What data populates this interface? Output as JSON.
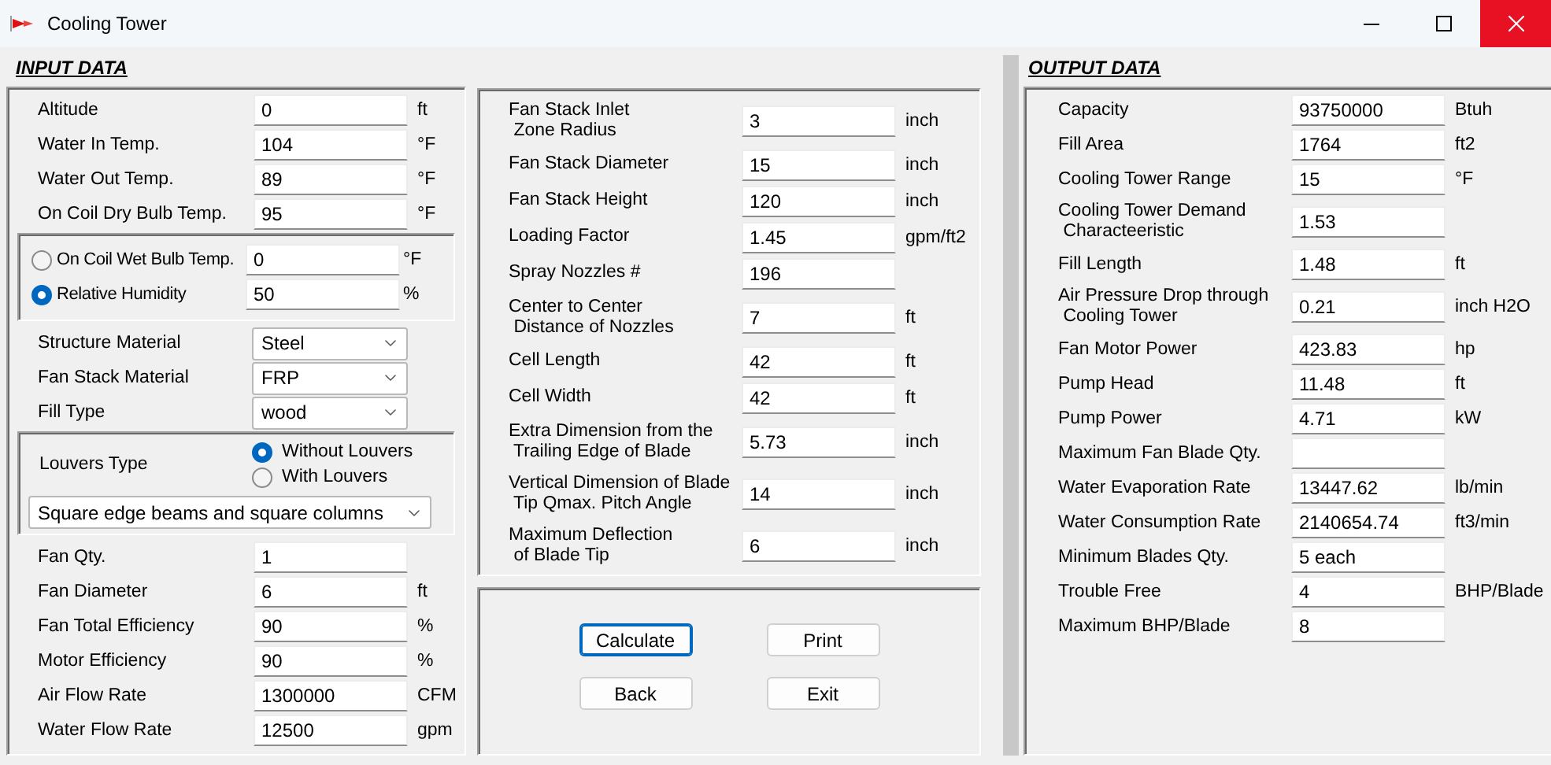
{
  "window": {
    "title": "Cooling Tower"
  },
  "input_data": {
    "title": "INPUT DATA",
    "basic_fields": [
      {
        "label": "Altitude",
        "value": "0",
        "unit": "ft"
      },
      {
        "label": "Water In Temp.",
        "value": "104",
        "unit": "°F"
      },
      {
        "label": "Water Out Temp.",
        "value": "89",
        "unit": "°F"
      },
      {
        "label": "On Coil Dry Bulb Temp.",
        "value": "95",
        "unit": "°F"
      }
    ],
    "humidity_options": [
      {
        "label": "On Coil Wet Bulb Temp.",
        "value": "0",
        "unit": "°F",
        "selected": false
      },
      {
        "label": "Relative Humidity",
        "value": "50",
        "unit": "%",
        "selected": true
      }
    ],
    "dropdowns": [
      {
        "label": "Structure Material",
        "value": "Steel"
      },
      {
        "label": "Fan Stack Material",
        "value": "FRP"
      },
      {
        "label": "Fill Type",
        "value": "wood"
      }
    ],
    "louvers": {
      "label": "Louvers Type",
      "options": [
        {
          "label": "Without Louvers",
          "selected": true
        },
        {
          "label": "With Louvers",
          "selected": false
        }
      ],
      "construction": "Square edge beams and square columns"
    },
    "fan_fields": [
      {
        "label": "Fan Qty.",
        "value": "1"
      },
      {
        "label": "Fan Diameter",
        "value": "6",
        "unit": "ft"
      },
      {
        "label": "Fan Total Efficiency",
        "value": "90",
        "unit": "%"
      },
      {
        "label": "Motor Efficiency",
        "value": "90",
        "unit": "%"
      },
      {
        "label": "Air Flow Rate",
        "value": "1300000",
        "unit": "CFM"
      },
      {
        "label": "Water Flow Rate",
        "value": "12500",
        "unit": "gpm"
      }
    ]
  },
  "fan_stack": {
    "fields": [
      {
        "label": "Fan Stack Inlet\n Zone Radius",
        "value": "3",
        "unit": "inch"
      },
      {
        "label": "Fan Stack Diameter",
        "value": "15",
        "unit": "inch"
      },
      {
        "label": "Fan Stack Height",
        "value": "120",
        "unit": "inch"
      },
      {
        "label": "Loading Factor",
        "value": "1.45",
        "unit": "gpm/ft2"
      },
      {
        "label": "Spray Nozzles #",
        "value": "196"
      },
      {
        "label": "Center to Center\n Distance of Nozzles",
        "value": "7",
        "unit": "ft"
      },
      {
        "label": "Cell Length",
        "value": "42",
        "unit": "ft"
      },
      {
        "label": "Cell Width",
        "value": "42",
        "unit": "ft"
      },
      {
        "label": "Extra Dimension from the\n Trailing Edge of Blade",
        "value": "5.73",
        "unit": "inch"
      },
      {
        "label": "Vertical Dimension of Blade\n Tip Qmax. Pitch Angle",
        "value": "14",
        "unit": "inch"
      },
      {
        "label": "Maximum Deflection\n of Blade Tip",
        "value": "6",
        "unit": "inch"
      }
    ]
  },
  "buttons": [
    {
      "label": "Calculate",
      "focused": true
    },
    {
      "label": "Print",
      "focused": false
    },
    {
      "label": "Back",
      "focused": false
    },
    {
      "label": "Exit",
      "focused": false
    }
  ],
  "output_data": {
    "title": "OUTPUT DATA",
    "fields": [
      {
        "label": "Capacity",
        "value": "93750000",
        "unit": "Btuh"
      },
      {
        "label": "Fill Area",
        "value": "1764",
        "unit": "ft2"
      },
      {
        "label": "Cooling Tower Range",
        "value": "15",
        "unit": "°F"
      },
      {
        "label": "Cooling Tower Demand\n Characteeristic",
        "value": "1.53"
      },
      {
        "label": "Fill Length",
        "value": "1.48",
        "unit": "ft"
      },
      {
        "label": "Air Pressure Drop through\n Cooling Tower",
        "value": "0.21",
        "unit": "inch H2O"
      },
      {
        "label": "Fan Motor Power",
        "value": "423.83",
        "unit": "hp"
      },
      {
        "label": "Pump Head",
        "value": "11.48",
        "unit": "ft"
      },
      {
        "label": "Pump Power",
        "value": "4.71",
        "unit": "kW"
      },
      {
        "label": "Maximum Fan Blade Qty."
      },
      {
        "label": "Water Evaporation Rate",
        "value": "13447.62",
        "unit": "lb/min"
      },
      {
        "label": "Water Consumption Rate",
        "value": "2140654.74",
        "unit": "ft3/min"
      },
      {
        "label": "Minimum Blades Qty.",
        "value": "5 each"
      },
      {
        "label": "Trouble Free",
        "value": "4",
        "unit": "BHP/Blade"
      },
      {
        "label": "Maximum BHP/Blade",
        "value": "8"
      }
    ]
  }
}
